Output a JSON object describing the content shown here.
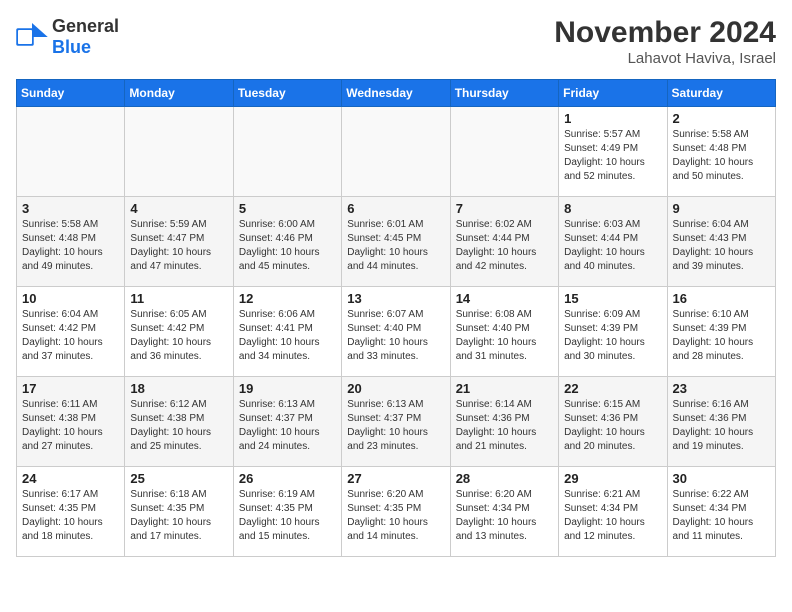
{
  "logo": {
    "general": "General",
    "blue": "Blue"
  },
  "title": "November 2024",
  "subtitle": "Lahavot Haviva, Israel",
  "days": [
    "Sunday",
    "Monday",
    "Tuesday",
    "Wednesday",
    "Thursday",
    "Friday",
    "Saturday"
  ],
  "weeks": [
    [
      {
        "day": "",
        "info": ""
      },
      {
        "day": "",
        "info": ""
      },
      {
        "day": "",
        "info": ""
      },
      {
        "day": "",
        "info": ""
      },
      {
        "day": "",
        "info": ""
      },
      {
        "day": "1",
        "info": "Sunrise: 5:57 AM\nSunset: 4:49 PM\nDaylight: 10 hours\nand 52 minutes."
      },
      {
        "day": "2",
        "info": "Sunrise: 5:58 AM\nSunset: 4:48 PM\nDaylight: 10 hours\nand 50 minutes."
      }
    ],
    [
      {
        "day": "3",
        "info": "Sunrise: 5:58 AM\nSunset: 4:48 PM\nDaylight: 10 hours\nand 49 minutes."
      },
      {
        "day": "4",
        "info": "Sunrise: 5:59 AM\nSunset: 4:47 PM\nDaylight: 10 hours\nand 47 minutes."
      },
      {
        "day": "5",
        "info": "Sunrise: 6:00 AM\nSunset: 4:46 PM\nDaylight: 10 hours\nand 45 minutes."
      },
      {
        "day": "6",
        "info": "Sunrise: 6:01 AM\nSunset: 4:45 PM\nDaylight: 10 hours\nand 44 minutes."
      },
      {
        "day": "7",
        "info": "Sunrise: 6:02 AM\nSunset: 4:44 PM\nDaylight: 10 hours\nand 42 minutes."
      },
      {
        "day": "8",
        "info": "Sunrise: 6:03 AM\nSunset: 4:44 PM\nDaylight: 10 hours\nand 40 minutes."
      },
      {
        "day": "9",
        "info": "Sunrise: 6:04 AM\nSunset: 4:43 PM\nDaylight: 10 hours\nand 39 minutes."
      }
    ],
    [
      {
        "day": "10",
        "info": "Sunrise: 6:04 AM\nSunset: 4:42 PM\nDaylight: 10 hours\nand 37 minutes."
      },
      {
        "day": "11",
        "info": "Sunrise: 6:05 AM\nSunset: 4:42 PM\nDaylight: 10 hours\nand 36 minutes."
      },
      {
        "day": "12",
        "info": "Sunrise: 6:06 AM\nSunset: 4:41 PM\nDaylight: 10 hours\nand 34 minutes."
      },
      {
        "day": "13",
        "info": "Sunrise: 6:07 AM\nSunset: 4:40 PM\nDaylight: 10 hours\nand 33 minutes."
      },
      {
        "day": "14",
        "info": "Sunrise: 6:08 AM\nSunset: 4:40 PM\nDaylight: 10 hours\nand 31 minutes."
      },
      {
        "day": "15",
        "info": "Sunrise: 6:09 AM\nSunset: 4:39 PM\nDaylight: 10 hours\nand 30 minutes."
      },
      {
        "day": "16",
        "info": "Sunrise: 6:10 AM\nSunset: 4:39 PM\nDaylight: 10 hours\nand 28 minutes."
      }
    ],
    [
      {
        "day": "17",
        "info": "Sunrise: 6:11 AM\nSunset: 4:38 PM\nDaylight: 10 hours\nand 27 minutes."
      },
      {
        "day": "18",
        "info": "Sunrise: 6:12 AM\nSunset: 4:38 PM\nDaylight: 10 hours\nand 25 minutes."
      },
      {
        "day": "19",
        "info": "Sunrise: 6:13 AM\nSunset: 4:37 PM\nDaylight: 10 hours\nand 24 minutes."
      },
      {
        "day": "20",
        "info": "Sunrise: 6:13 AM\nSunset: 4:37 PM\nDaylight: 10 hours\nand 23 minutes."
      },
      {
        "day": "21",
        "info": "Sunrise: 6:14 AM\nSunset: 4:36 PM\nDaylight: 10 hours\nand 21 minutes."
      },
      {
        "day": "22",
        "info": "Sunrise: 6:15 AM\nSunset: 4:36 PM\nDaylight: 10 hours\nand 20 minutes."
      },
      {
        "day": "23",
        "info": "Sunrise: 6:16 AM\nSunset: 4:36 PM\nDaylight: 10 hours\nand 19 minutes."
      }
    ],
    [
      {
        "day": "24",
        "info": "Sunrise: 6:17 AM\nSunset: 4:35 PM\nDaylight: 10 hours\nand 18 minutes."
      },
      {
        "day": "25",
        "info": "Sunrise: 6:18 AM\nSunset: 4:35 PM\nDaylight: 10 hours\nand 17 minutes."
      },
      {
        "day": "26",
        "info": "Sunrise: 6:19 AM\nSunset: 4:35 PM\nDaylight: 10 hours\nand 15 minutes."
      },
      {
        "day": "27",
        "info": "Sunrise: 6:20 AM\nSunset: 4:35 PM\nDaylight: 10 hours\nand 14 minutes."
      },
      {
        "day": "28",
        "info": "Sunrise: 6:20 AM\nSunset: 4:34 PM\nDaylight: 10 hours\nand 13 minutes."
      },
      {
        "day": "29",
        "info": "Sunrise: 6:21 AM\nSunset: 4:34 PM\nDaylight: 10 hours\nand 12 minutes."
      },
      {
        "day": "30",
        "info": "Sunrise: 6:22 AM\nSunset: 4:34 PM\nDaylight: 10 hours\nand 11 minutes."
      }
    ]
  ]
}
